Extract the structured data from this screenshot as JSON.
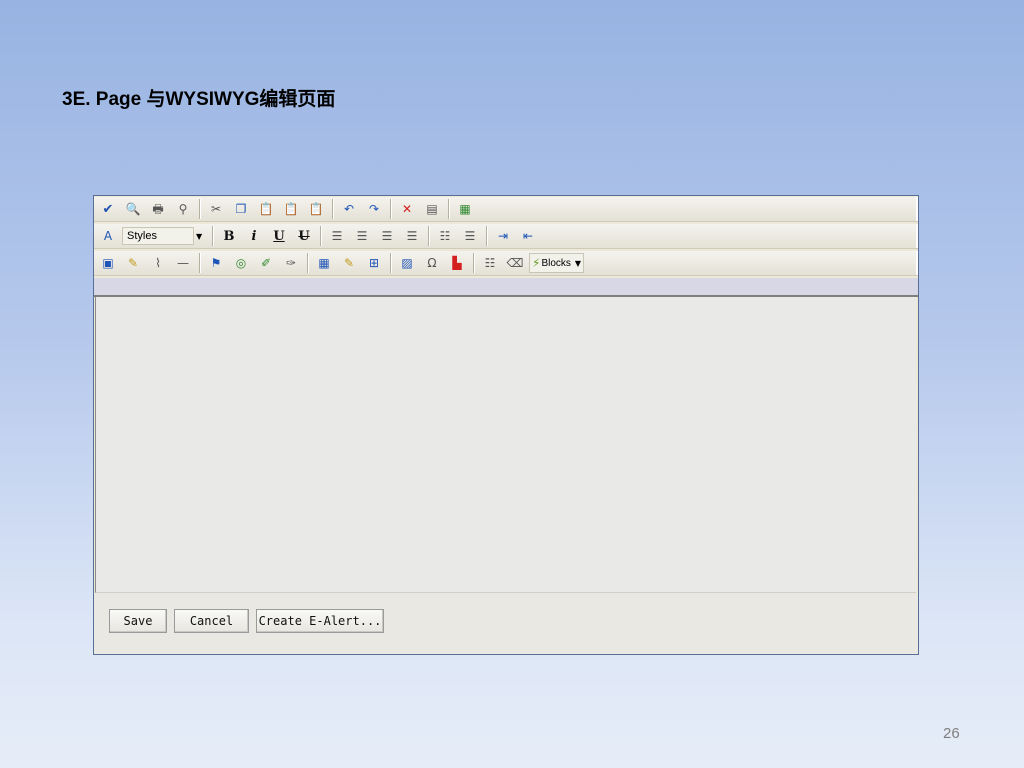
{
  "slide": {
    "title": "3E. Page 与WYSIWYG编辑页面",
    "page_number": "26"
  },
  "toolbar": {
    "row1": [
      "spellcheck-icon",
      "preview-icon",
      "print-icon",
      "find-icon",
      "|",
      "cut-icon",
      "copy-icon",
      "paste-icon",
      "paste-text-icon",
      "paste-word-icon",
      "|",
      "undo-icon",
      "redo-icon",
      "|",
      "remove-format-icon",
      "source-icon",
      "|",
      "presentation-icon"
    ],
    "row2": [
      "style-icon",
      "styles-select",
      "|",
      "bold-icon",
      "italic-icon",
      "underline-icon",
      "strikethrough-icon",
      "|",
      "align-left-icon",
      "align-center-icon",
      "align-right-icon",
      "justify-icon",
      "|",
      "numbered-list-icon",
      "bulleted-list-icon",
      "|",
      "indent-icon",
      "outdent-icon"
    ],
    "row3": [
      "image-icon",
      "edit-icon",
      "attach-icon",
      "horizontal-rule-icon",
      "|",
      "link-icon",
      "anchor-icon",
      "link-edit-icon",
      "unlink-icon",
      "|",
      "table-icon",
      "table-edit-icon",
      "table-grid-icon",
      "|",
      "picture-icon",
      "special-char-icon",
      "chart-icon",
      "|",
      "page-break-icon",
      "erase-icon",
      "blocks-select"
    ],
    "styles_label": "Styles",
    "blocks_label": "Blocks"
  },
  "glyphs": {
    "spellcheck-icon": "✔",
    "preview-icon": "🔍",
    "print-icon": "🖶",
    "find-icon": "⚲",
    "cut-icon": "✂",
    "copy-icon": "❐",
    "paste-icon": "📋",
    "paste-text-icon": "📋",
    "paste-word-icon": "📋",
    "undo-icon": "↶",
    "redo-icon": "↷",
    "remove-format-icon": "✕",
    "source-icon": "▤",
    "presentation-icon": "▦",
    "style-icon": "A",
    "bold-icon": "B",
    "italic-icon": "i",
    "underline-icon": "U",
    "strikethrough-icon": "U",
    "align-left-icon": "☰",
    "align-center-icon": "☰",
    "align-right-icon": "☰",
    "justify-icon": "☰",
    "numbered-list-icon": "☷",
    "bulleted-list-icon": "☰",
    "indent-icon": "⇥",
    "outdent-icon": "⇤",
    "image-icon": "▣",
    "edit-icon": "✎",
    "attach-icon": "⌇",
    "horizontal-rule-icon": "—",
    "link-icon": "⚑",
    "anchor-icon": "◎",
    "link-edit-icon": "✐",
    "unlink-icon": "✑",
    "table-icon": "▦",
    "table-edit-icon": "✎",
    "table-grid-icon": "⊞",
    "picture-icon": "▨",
    "special-char-icon": "Ω",
    "chart-icon": "▙",
    "page-break-icon": "☷",
    "erase-icon": "⌫"
  },
  "buttons": {
    "save": "Save",
    "cancel": "Cancel",
    "create_alert": "Create E-Alert..."
  }
}
